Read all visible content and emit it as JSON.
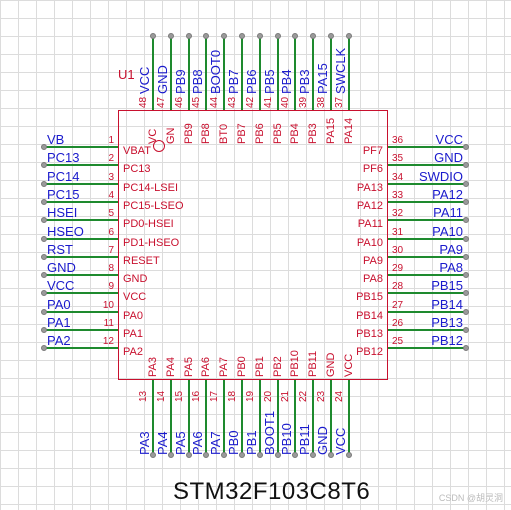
{
  "ref": "U1",
  "part_number": "STM32F103C8T6",
  "watermark": "CSDN @胡灵洞",
  "colors": {
    "wire": "#1e8a2e",
    "body": "#c8102e",
    "net": "#1a1acc",
    "pin": "#c8102e"
  },
  "left_pins": [
    {
      "num": "1",
      "name": "VBAT",
      "net": "VB"
    },
    {
      "num": "2",
      "name": "PC13",
      "net": "PC13"
    },
    {
      "num": "3",
      "name": "PC14-LSEI",
      "net": "PC14"
    },
    {
      "num": "4",
      "name": "PC15-LSEO",
      "net": "PC15"
    },
    {
      "num": "5",
      "name": "PD0-HSEI",
      "net": "HSEI"
    },
    {
      "num": "6",
      "name": "PD1-HSEO",
      "net": "HSEO"
    },
    {
      "num": "7",
      "name": "RESET",
      "net": "RST"
    },
    {
      "num": "8",
      "name": "GND",
      "net": "GND"
    },
    {
      "num": "9",
      "name": "VCC",
      "net": "VCC"
    },
    {
      "num": "10",
      "name": "PA0",
      "net": "PA0"
    },
    {
      "num": "11",
      "name": "PA1",
      "net": "PA1"
    },
    {
      "num": "12",
      "name": "PA2",
      "net": "PA2"
    }
  ],
  "right_pins": [
    {
      "num": "36",
      "name": "PF7",
      "net": "VCC"
    },
    {
      "num": "35",
      "name": "PF6",
      "net": "GND"
    },
    {
      "num": "34",
      "name": "PA13",
      "net": "SWDIO"
    },
    {
      "num": "33",
      "name": "PA12",
      "net": "PA12"
    },
    {
      "num": "32",
      "name": "PA11",
      "net": "PA11"
    },
    {
      "num": "31",
      "name": "PA10",
      "net": "PA10"
    },
    {
      "num": "30",
      "name": "PA9",
      "net": "PA9"
    },
    {
      "num": "29",
      "name": "PA8",
      "net": "PA8"
    },
    {
      "num": "28",
      "name": "PB15",
      "net": "PB15"
    },
    {
      "num": "27",
      "name": "PB14",
      "net": "PB14"
    },
    {
      "num": "26",
      "name": "PB13",
      "net": "PB13"
    },
    {
      "num": "25",
      "name": "PB12",
      "net": "PB12"
    }
  ],
  "top_pins": [
    {
      "num": "48",
      "name": "VC",
      "net": "VCC"
    },
    {
      "num": "47",
      "name": "GN",
      "net": "GND"
    },
    {
      "num": "46",
      "name": "PB9",
      "net": "PB9"
    },
    {
      "num": "45",
      "name": "PB8",
      "net": "PB8"
    },
    {
      "num": "44",
      "name": "BT0",
      "net": "BOOT0"
    },
    {
      "num": "43",
      "name": "PB7",
      "net": "PB7"
    },
    {
      "num": "42",
      "name": "PB6",
      "net": "PB6"
    },
    {
      "num": "41",
      "name": "PB5",
      "net": "PB5"
    },
    {
      "num": "40",
      "name": "PB4",
      "net": "PB4"
    },
    {
      "num": "39",
      "name": "PB3",
      "net": "PB3"
    },
    {
      "num": "38",
      "name": "PA15",
      "net": "PA15"
    },
    {
      "num": "37",
      "name": "PA14",
      "net": "SWCLK"
    }
  ],
  "bottom_pins": [
    {
      "num": "13",
      "name": "PA3",
      "net": "PA3"
    },
    {
      "num": "14",
      "name": "PA4",
      "net": "PA4"
    },
    {
      "num": "15",
      "name": "PA5",
      "net": "PA5"
    },
    {
      "num": "16",
      "name": "PA6",
      "net": "PA6"
    },
    {
      "num": "17",
      "name": "PA7",
      "net": "PA7"
    },
    {
      "num": "18",
      "name": "PB0",
      "net": "PB0"
    },
    {
      "num": "19",
      "name": "PB1",
      "net": "PB1"
    },
    {
      "num": "20",
      "name": "PB2",
      "net": "BOOT1"
    },
    {
      "num": "21",
      "name": "PB10",
      "net": "PB10"
    },
    {
      "num": "22",
      "name": "PB11",
      "net": "PB11"
    },
    {
      "num": "23",
      "name": "GND",
      "net": "GND"
    },
    {
      "num": "24",
      "name": "VCC",
      "net": "VCC"
    }
  ]
}
